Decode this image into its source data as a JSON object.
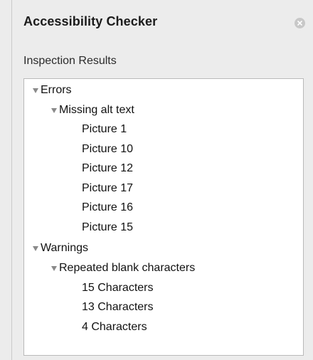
{
  "panel": {
    "title": "Accessibility Checker",
    "close_icon": "close-icon",
    "section_label": "Inspection Results"
  },
  "tree": {
    "errors": {
      "label": "Errors",
      "missing_alt_text": {
        "label": "Missing alt text",
        "items": [
          "Picture 1",
          "Picture 10",
          "Picture 12",
          "Picture 17",
          "Picture 16",
          "Picture 15"
        ]
      }
    },
    "warnings": {
      "label": "Warnings",
      "repeated_blank": {
        "label": "Repeated blank characters",
        "items": [
          "15 Characters",
          "13 Characters",
          "4 Characters"
        ]
      }
    }
  }
}
